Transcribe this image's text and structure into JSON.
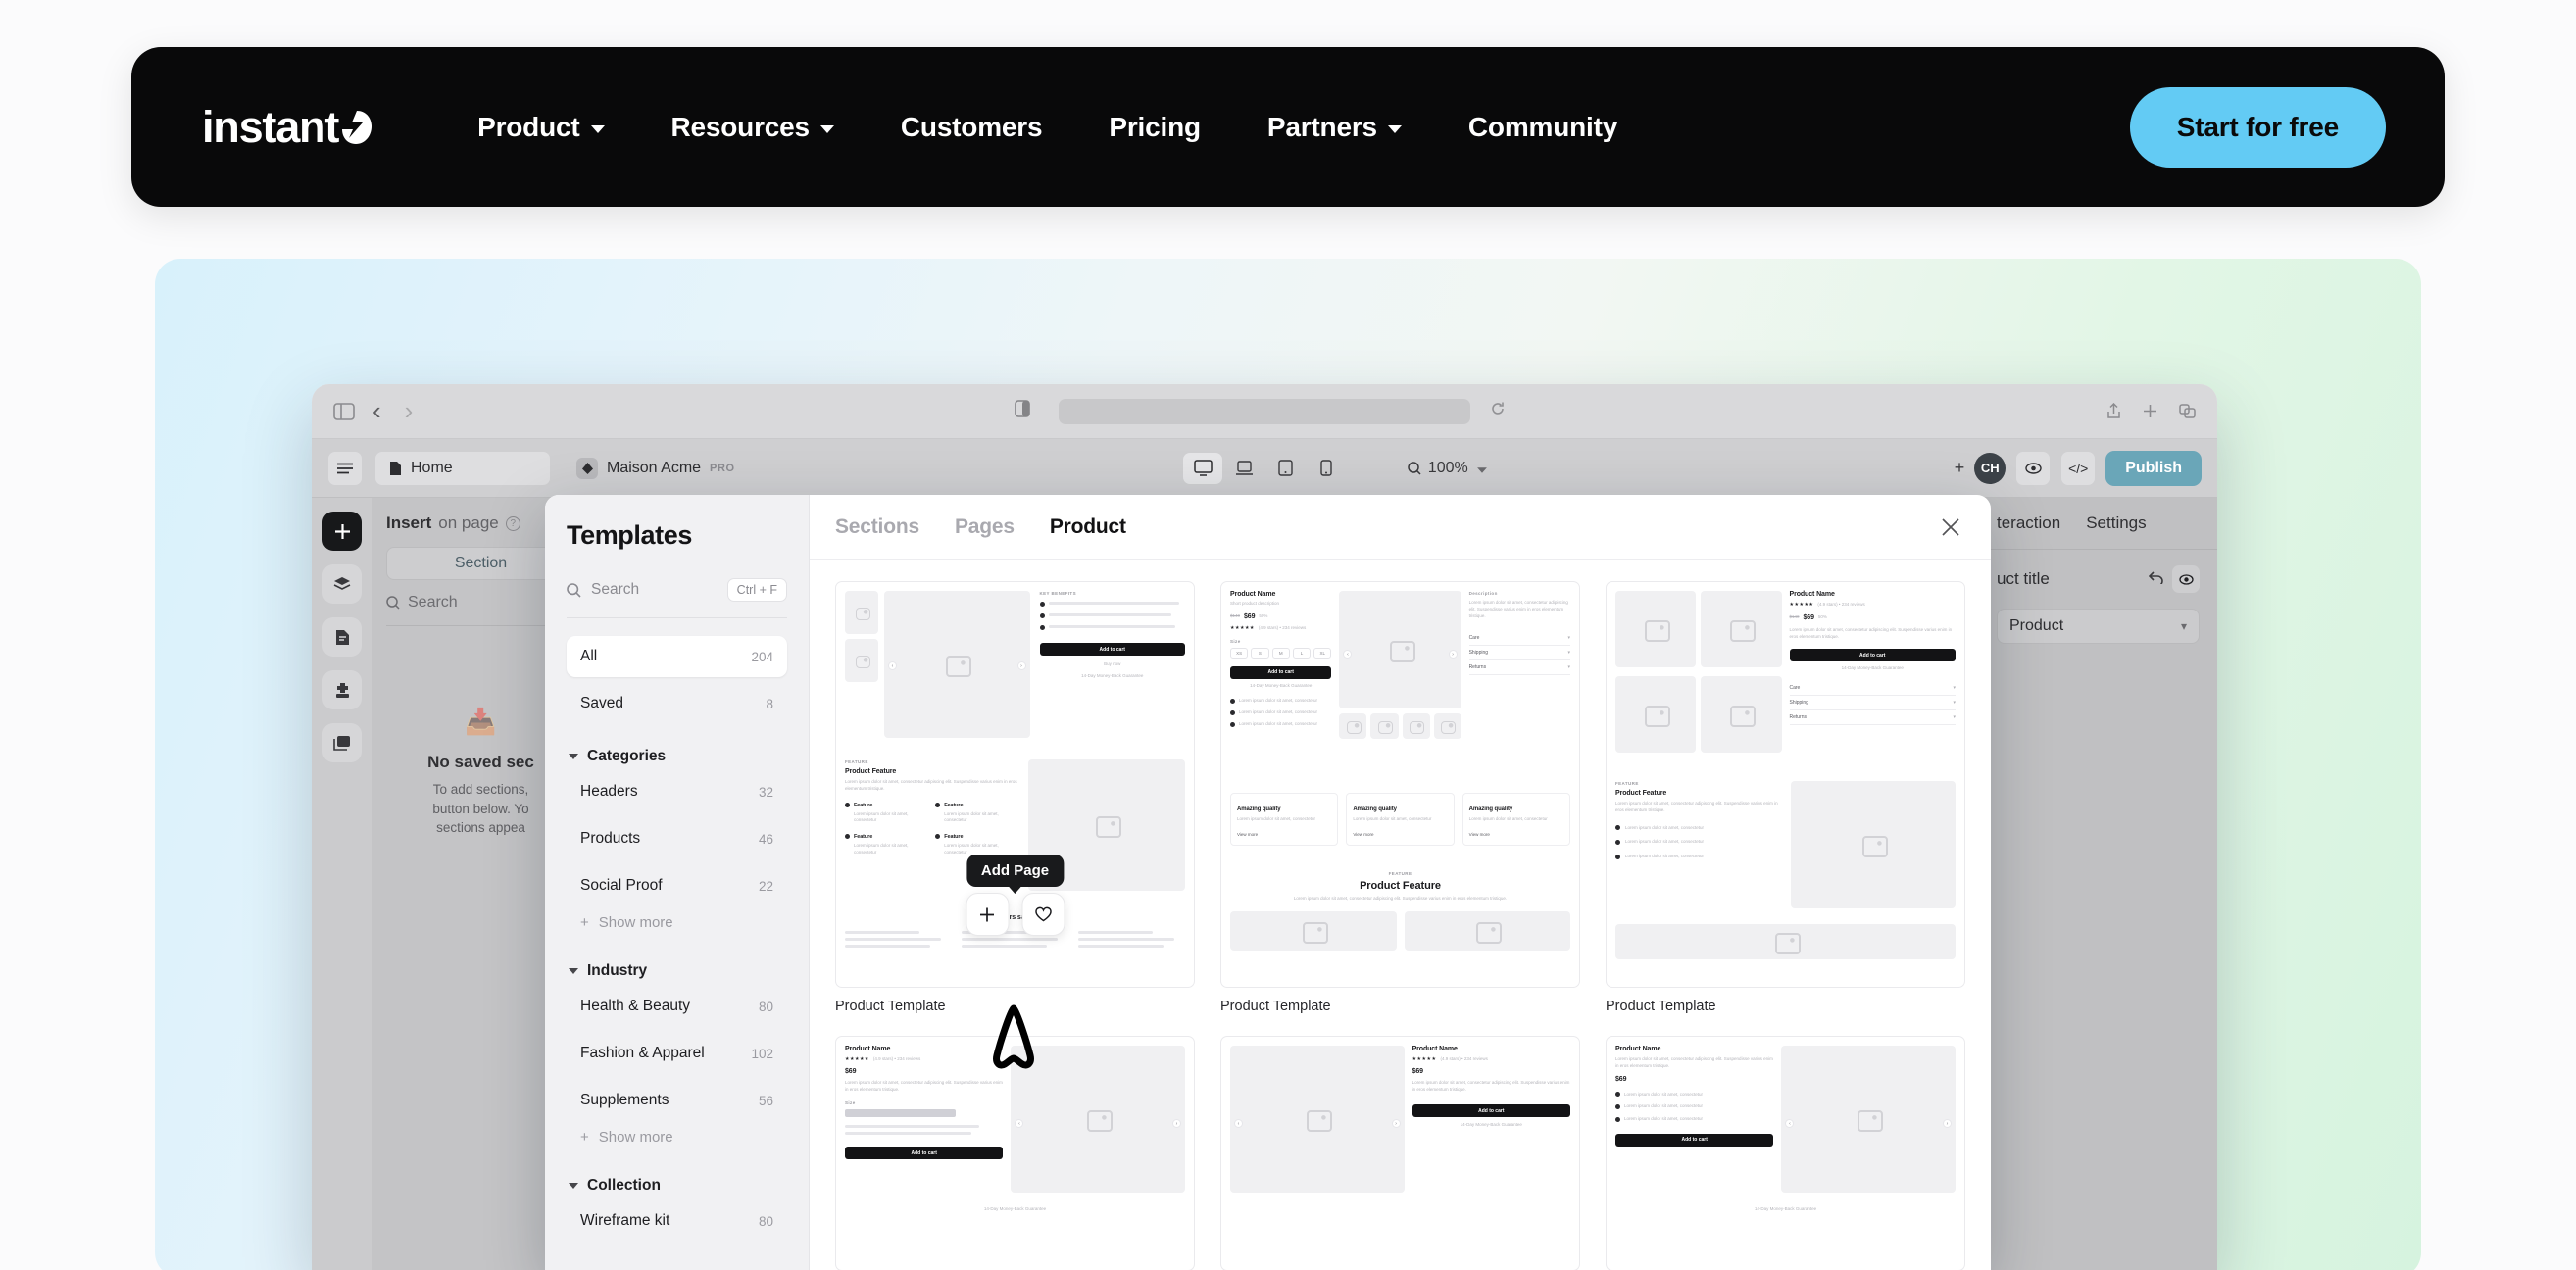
{
  "navbar": {
    "logo_text": "instant",
    "logo_icon": "lightning-bolt-icon",
    "links": [
      {
        "label": "Product",
        "has_caret": true
      },
      {
        "label": "Resources",
        "has_caret": true
      },
      {
        "label": "Customers",
        "has_caret": false
      },
      {
        "label": "Pricing",
        "has_caret": false
      },
      {
        "label": "Partners",
        "has_caret": true
      },
      {
        "label": "Community",
        "has_caret": false
      }
    ],
    "cta_label": "Start for free",
    "cta_color": "#63cbf4",
    "background": "#09090a"
  },
  "browser": {
    "sidebar_toggle_icon": "sidebar-icon",
    "back_icon": "chevron-left-icon",
    "forward_icon": "chevron-right-icon",
    "reader_icon": "reader-view-icon",
    "share_icon": "share-icon",
    "new_tab_icon": "plus-icon",
    "tabs_icon": "tabs-icon",
    "refresh_icon": "refresh-icon"
  },
  "editor": {
    "menu_icon": "hamburger-icon",
    "page_label": "Home",
    "page_icon": "file-icon",
    "store_label": "Maison Acme",
    "store_icon": "store-icon",
    "plan_badge": "PRO",
    "devices": [
      {
        "name": "desktop",
        "icon": "desktop-icon",
        "active": true
      },
      {
        "name": "laptop",
        "icon": "laptop-icon",
        "active": false
      },
      {
        "name": "tablet",
        "icon": "tablet-icon",
        "active": false
      },
      {
        "name": "mobile",
        "icon": "mobile-icon",
        "active": false
      }
    ],
    "zoom_level": "100%",
    "avatar_initials": "CH",
    "preview_icon": "eye-icon",
    "code_icon": "code-icon",
    "publish_label": "Publish",
    "publish_color": "#6aa6b8",
    "rail": [
      {
        "name": "add",
        "icon": "plus-icon",
        "active": true
      },
      {
        "name": "layers",
        "icon": "layers-icon",
        "active": false
      },
      {
        "name": "pages",
        "icon": "document-icon",
        "active": false
      },
      {
        "name": "apps",
        "icon": "puzzle-icon",
        "active": false
      },
      {
        "name": "library",
        "icon": "images-icon",
        "active": false
      }
    ],
    "insert": {
      "title_bold": "Insert",
      "title_muted": "on page",
      "help_icon": "question-icon",
      "tab_label": "Section",
      "search_placeholder": "Search",
      "search_icon": "search-icon",
      "empty_icon": "upload-icon",
      "empty_title": "No saved sec",
      "empty_sub_line1": "To add sections,",
      "empty_sub_line2": "button below. Yo",
      "empty_sub_line3": "sections appea"
    },
    "right_panel": {
      "tabs": [
        "teraction",
        "Settings"
      ],
      "field_label": "uct title",
      "undo_icon": "undo-icon",
      "eye_icon": "eye-icon",
      "select_value": "Product",
      "chevron_icon": "chevron-down-icon"
    }
  },
  "modal": {
    "title": "Templates",
    "search_placeholder": "Search",
    "search_icon": "search-icon",
    "search_shortcut": "Ctrl + F",
    "close_icon": "close-icon",
    "tabs": [
      {
        "label": "Sections",
        "active": false
      },
      {
        "label": "Pages",
        "active": false
      },
      {
        "label": "Product",
        "active": true
      }
    ],
    "quick_filters": [
      {
        "label": "All",
        "count": "204",
        "active": true
      },
      {
        "label": "Saved",
        "count": "8",
        "active": false
      }
    ],
    "groups": [
      {
        "name": "Categories",
        "expanded": true,
        "items": [
          {
            "label": "Headers",
            "count": "32"
          },
          {
            "label": "Products",
            "count": "46"
          },
          {
            "label": "Social Proof",
            "count": "22"
          }
        ],
        "show_more": "Show more"
      },
      {
        "name": "Industry",
        "expanded": true,
        "items": [
          {
            "label": "Health & Beauty",
            "count": "80"
          },
          {
            "label": "Fashion & Apparel",
            "count": "102"
          },
          {
            "label": "Supplements",
            "count": "56"
          }
        ],
        "show_more": "Show more"
      },
      {
        "name": "Collection",
        "expanded": true,
        "items": [
          {
            "label": "Wireframe kit",
            "count": "80"
          }
        ],
        "show_more": ""
      }
    ],
    "tooltip": "Add Page",
    "add_icon": "plus-icon",
    "favorite_icon": "heart-icon",
    "cards": [
      {
        "label": "Product Template"
      },
      {
        "label": "Product Template"
      },
      {
        "label": "Product Template"
      },
      {
        "label": "Product Template"
      },
      {
        "label": "Product Template"
      },
      {
        "label": "Product Template"
      }
    ]
  },
  "wireframe": {
    "product_name": "Product Name",
    "product_sub": "Short product description",
    "price": "$69",
    "price_old": "$140",
    "price_badge": "50%",
    "rating": "★★★★★",
    "rating_text": "(4.9 stars) • 234 reviews",
    "size_label": "Size",
    "sizes": [
      "XS",
      "S",
      "M",
      "L",
      "XL"
    ],
    "add_to_cart": "Add to cart",
    "guarantee": "14-Day Money-Back Guarantee",
    "description_label": "Description",
    "accordions": [
      "Care",
      "Shipping",
      "Returns"
    ],
    "feature_eyebrow": "FEATURE",
    "feature_title": "Product Feature",
    "feature_item": "Feature",
    "quality_title": "Amazing quality",
    "view_more": "View more",
    "testimonial_title": "ners say",
    "highlights": "KEY BENEFITS",
    "buy_now": "Buy now",
    "lorem_short": "Lorem ipsum dolor sit amet, consectetur",
    "lorem_long": "Lorem ipsum dolor sit amet, consectetur adipiscing elit. Suspendisse varius enim in eros elementum tristique."
  },
  "annotation": {
    "shape": "hand-drawn-cursor-outline",
    "color": "#000000"
  }
}
